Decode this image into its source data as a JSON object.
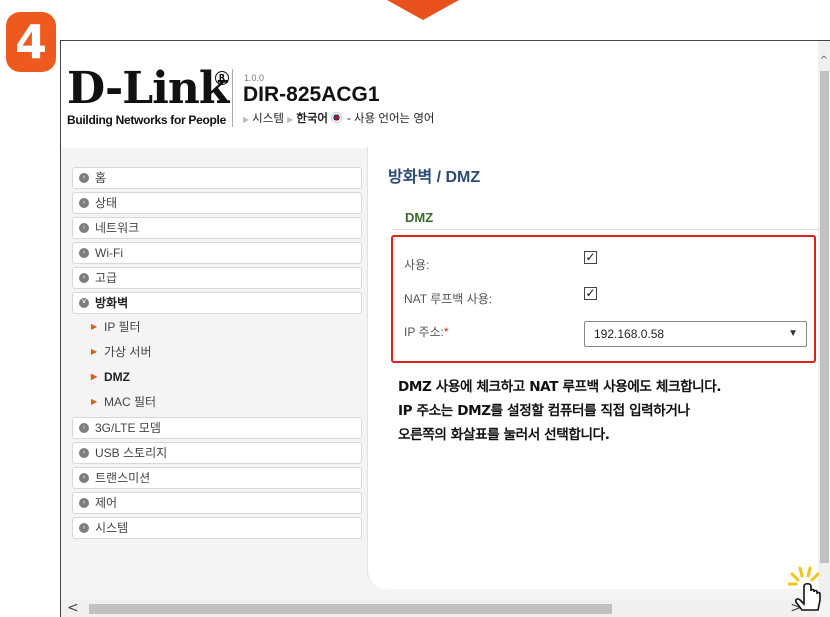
{
  "step_badge": "4",
  "header": {
    "logo_text": "D-Link",
    "logo_tagline": "Building Networks for People",
    "fw_version": "1.0.0",
    "model": "DIR-825ACG1",
    "link_system": "시스템",
    "link_language": "한국어",
    "language_note": "- 사용 언어는 영어"
  },
  "sidebar": {
    "items": [
      {
        "label": "홈"
      },
      {
        "label": "상태"
      },
      {
        "label": "네트워크"
      },
      {
        "label": "Wi-Fi"
      },
      {
        "label": "고급"
      },
      {
        "label": "방화벽"
      },
      {
        "label": "IP 필터"
      },
      {
        "label": "가상 서버"
      },
      {
        "label": "DMZ"
      },
      {
        "label": "MAC 필터"
      },
      {
        "label": "3G/LTE 모뎀"
      },
      {
        "label": "USB 스토리지"
      },
      {
        "label": "트랜스미션"
      },
      {
        "label": "제어"
      },
      {
        "label": "시스템"
      }
    ]
  },
  "content": {
    "page_title": "방화벽 /  DMZ",
    "section_title": "DMZ",
    "fields": {
      "enable_label": "사용:",
      "enable_checked": true,
      "nat_loopback_label": "NAT 루프백 사용:",
      "nat_loopback_checked": true,
      "ip_label": "IP 주소:",
      "ip_required_mark": "*",
      "ip_value": "192.168.0.58"
    }
  },
  "instruction": {
    "line1": "DMZ 사용에 체크하고 NAT 루프백 사용에도 체크합니다.",
    "line2": "IP 주소는 DMZ를 설정할 컴퓨터를 직접 입력하거나",
    "line3": "오른쪽의 화살표를 눌러서 선택합니다."
  },
  "colors": {
    "accent_orange": "#ee5a1d",
    "highlight_red": "#e0201c",
    "title_blue": "#2b4a74",
    "section_green": "#3a6b2a"
  },
  "icons": {
    "checkbox_mark": "✓",
    "select_arrow": "▼",
    "scroll_up": "^",
    "scroll_left": "<",
    "scroll_right": ">"
  }
}
